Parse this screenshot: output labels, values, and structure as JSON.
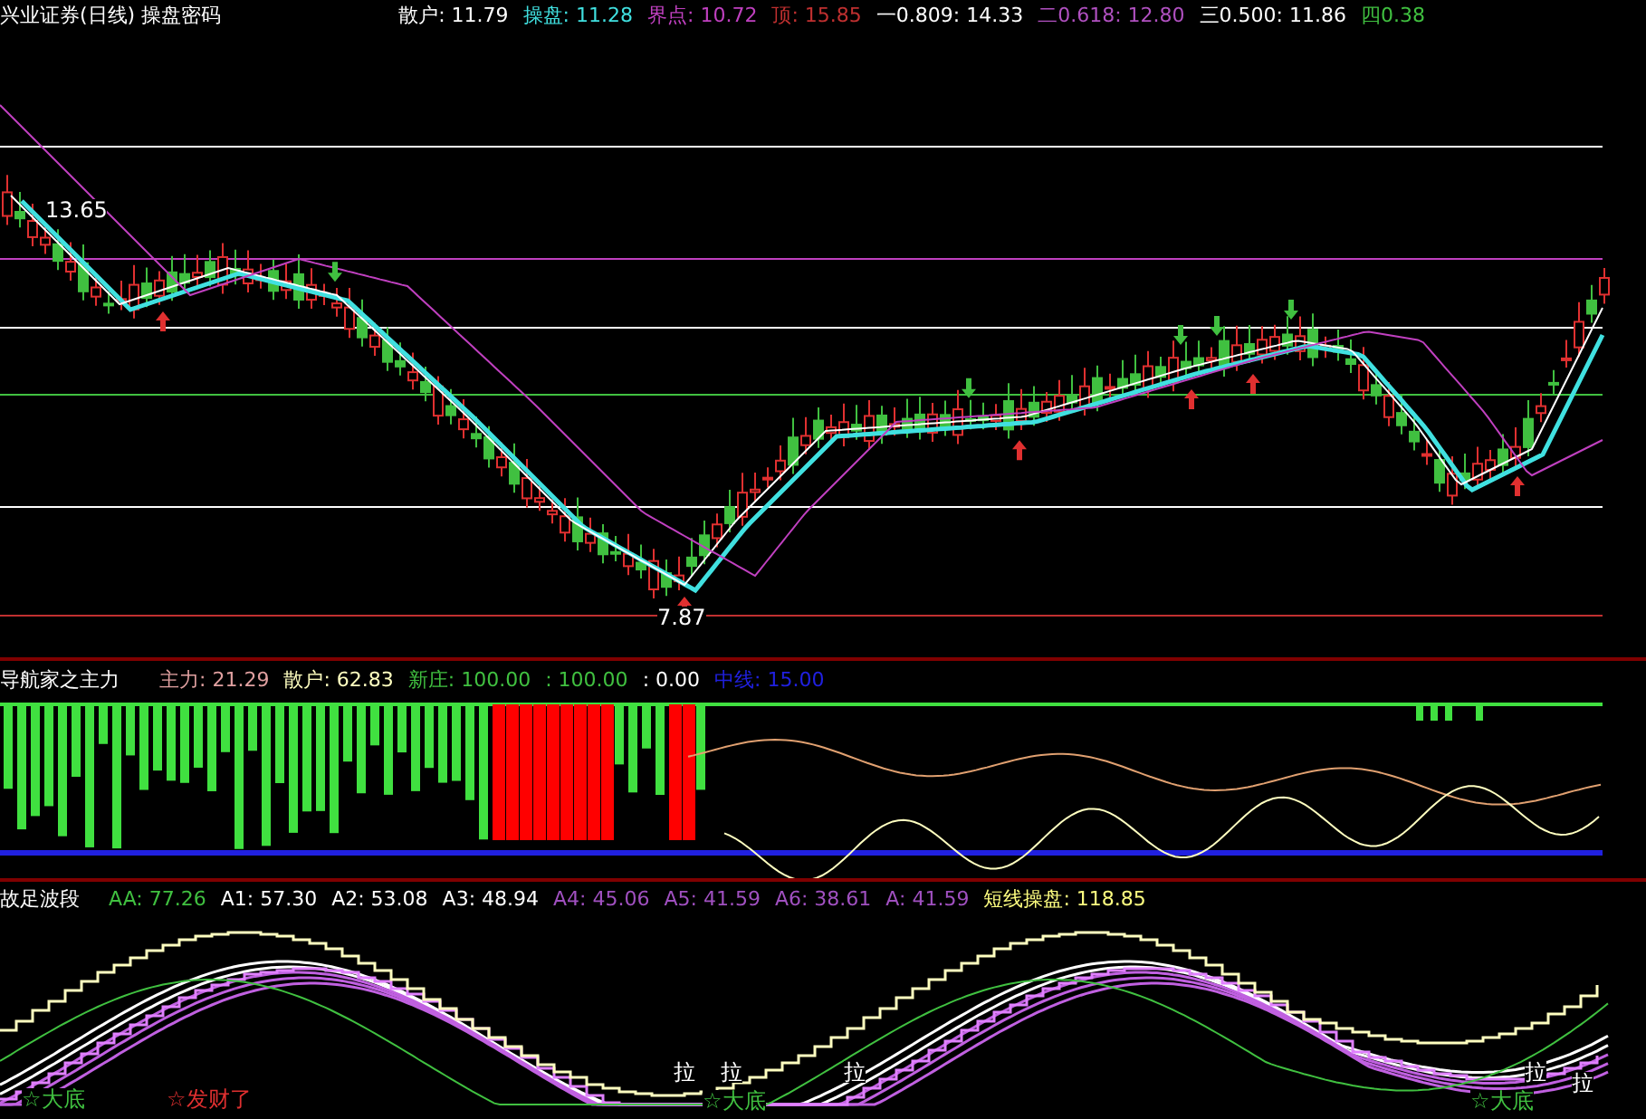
{
  "main_panel": {
    "title": "兴业证券(日线) 操盘密码",
    "indicators": [
      {
        "text": "散户: 11.79",
        "color": "#ffffff"
      },
      {
        "text": "操盘: 11.28",
        "color": "#40e0e0"
      },
      {
        "text": "界点: 10.72",
        "color": "#c040c0"
      },
      {
        "text": "顶: 15.85",
        "color": "#c03030"
      },
      {
        "text": "一0.809: 14.33",
        "color": "#ffffff"
      },
      {
        "text": "二0.618: 12.80",
        "color": "#b050c0"
      },
      {
        "text": "三0.500: 11.86",
        "color": "#ffffff"
      },
      {
        "text": "四0.38",
        "color": "#40c040"
      }
    ],
    "price_labels": [
      "13.65",
      "7.87"
    ]
  },
  "force_panel": {
    "title": "导航家之主力",
    "indicators": [
      {
        "text": "主力: 21.29",
        "color": "#e0a0a0"
      },
      {
        "text": "散户: 62.83",
        "color": "#ffffc0"
      },
      {
        "text": "新庄: 100.00",
        "color": "#40c040"
      },
      {
        "text": ": 100.00",
        "color": "#40c040"
      },
      {
        "text": ": 0.00",
        "color": "#ffffff"
      },
      {
        "text": "中线: 15.00",
        "color": "#2020e0"
      }
    ]
  },
  "wave_panel": {
    "title": "故足波段",
    "indicators": [
      {
        "text": "AA: 77.26",
        "color": "#40c040"
      },
      {
        "text": "A1: 57.30",
        "color": "#ffffff"
      },
      {
        "text": "A2: 53.08",
        "color": "#ffffff"
      },
      {
        "text": "A3: 48.94",
        "color": "#ffffff"
      },
      {
        "text": "A4: 45.06",
        "color": "#a050c0"
      },
      {
        "text": "A5: 41.59",
        "color": "#a050c0"
      },
      {
        "text": "A6: 38.61",
        "color": "#a050c0"
      },
      {
        "text": "A: 41.59",
        "color": "#a050c0"
      },
      {
        "text": "短线操盘: 118.85",
        "color": "#ffff80"
      }
    ],
    "signals": [
      {
        "text": "☆大底",
        "color": "#40c040"
      },
      {
        "text": "☆发财了",
        "color": "#e03030"
      },
      {
        "text": "拉",
        "color": "#ffffff"
      },
      {
        "text": "拉",
        "color": "#ffffff"
      },
      {
        "text": "☆大底",
        "color": "#40c040"
      },
      {
        "text": "拉",
        "color": "#ffffff"
      },
      {
        "text": "☆大底",
        "color": "#40c040"
      },
      {
        "text": "拉",
        "color": "#ffffff"
      },
      {
        "text": "拉",
        "color": "#ffffff"
      }
    ]
  }
}
